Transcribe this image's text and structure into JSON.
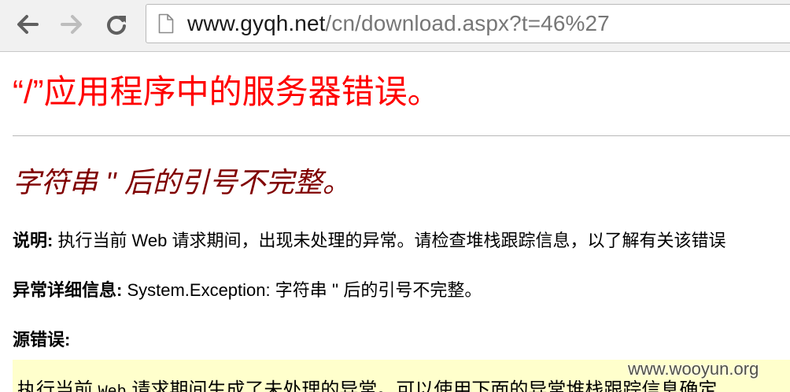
{
  "browser": {
    "url_host": "www.gyqh.net",
    "url_path": "/cn/download.aspx?t=46%27",
    "icons": {
      "back": "arrow-left-icon",
      "forward": "arrow-right-icon",
      "reload": "reload-icon",
      "page": "document-icon"
    },
    "colors": {
      "toolbar": "#f1f1f1",
      "url_host": "#1a1a1a",
      "url_path": "#777777"
    }
  },
  "page": {
    "title": "“/”应用程序中的服务器错误。",
    "subtitle": "字符串 '' 后的引号不完整。",
    "description_label": "说明:",
    "description_text": " 执行当前 Web 请求期间，出现未处理的异常。请检查堆栈跟踪信息，以了解有关该错误",
    "exception_label": "异常详细信息:",
    "exception_text": " System.Exception: 字符串 '' 后的引号不完整。",
    "source_error_label": "源错误:",
    "source_error_part1": "执行当前 ",
    "source_error_mono": "Web",
    "source_error_part2": " 请求期间生成了未处理的异常。可以使用下面的异常堆栈跟踪信息确定",
    "colors": {
      "title": "#ff0000",
      "subtitle": "#800000",
      "code_background": "#ffffcc"
    }
  },
  "watermark": "www.wooyun.org"
}
